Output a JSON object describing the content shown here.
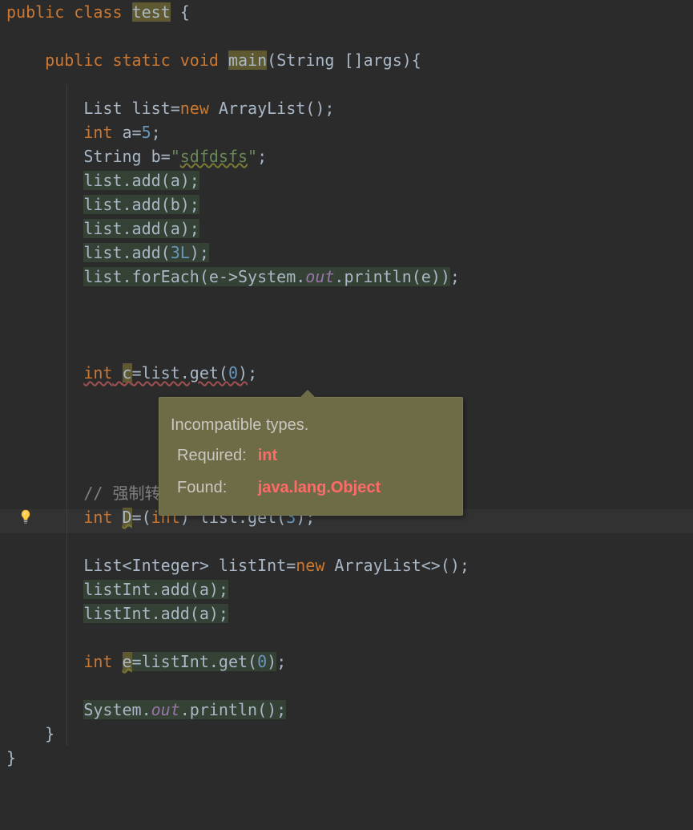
{
  "c": {
    "l1a": "public",
    "l1b": "class",
    "l1c": "test",
    "l1d": " {",
    "l2a": "public",
    "l2b": "static",
    "l2c": "void",
    "l2d": "main",
    "l2e": "(String []args){",
    "l3a": "List list=",
    "l3b": "new",
    "l3c": " ArrayList();",
    "l4a": "int",
    "l4b": " a=",
    "l4c": "5",
    "l4d": ";",
    "l5a": "String b=",
    "l5b": "\"",
    "l5c": "sdfdsfs",
    "l5d": "\"",
    "l5e": ";",
    "l6": "list.add(a);",
    "l7": "list.add(b);",
    "l8": "list.add(a);",
    "l9a": "list.add(",
    "l9b": "3L",
    "l9c": ");",
    "l10a": "list.forEach(e->System.",
    "l10b": "out",
    "l10c": ".println(e))",
    "l10d": ";",
    "l11a": "int",
    "l11sp": " ",
    "l11b": "c",
    "l11c": "=list.get(",
    "l11d": "0",
    "l11e": ")",
    "l11f": ";",
    "l12a": "// ",
    "l12b": "强制转换",
    "l13a": "int",
    "l13b": " ",
    "l13c": "D",
    "l13d": "=(",
    "l13e": "int",
    "l13f": ") list.get(",
    "l13g": "3",
    "l13h": ");",
    "l14a": "List<Integer> listInt=",
    "l14b": "new",
    "l14c": " ArrayList<>();",
    "l15": "listInt.add(a);",
    "l16": "listInt.add(a);",
    "l17a": "int",
    "l17b": " ",
    "l17c": "e",
    "l17d": "=listInt.get(",
    "l17e": "0",
    "l17f": ")",
    "l17g": ";",
    "l18a": "System.",
    "l18b": "out",
    "l18c": ".println();",
    "l19": "}",
    "l20": "}"
  },
  "tip": {
    "title": "Incompatible types.",
    "r1": "Required:",
    "r2": "int",
    "f1": "Found:",
    "f2": "java.lang.Object"
  }
}
